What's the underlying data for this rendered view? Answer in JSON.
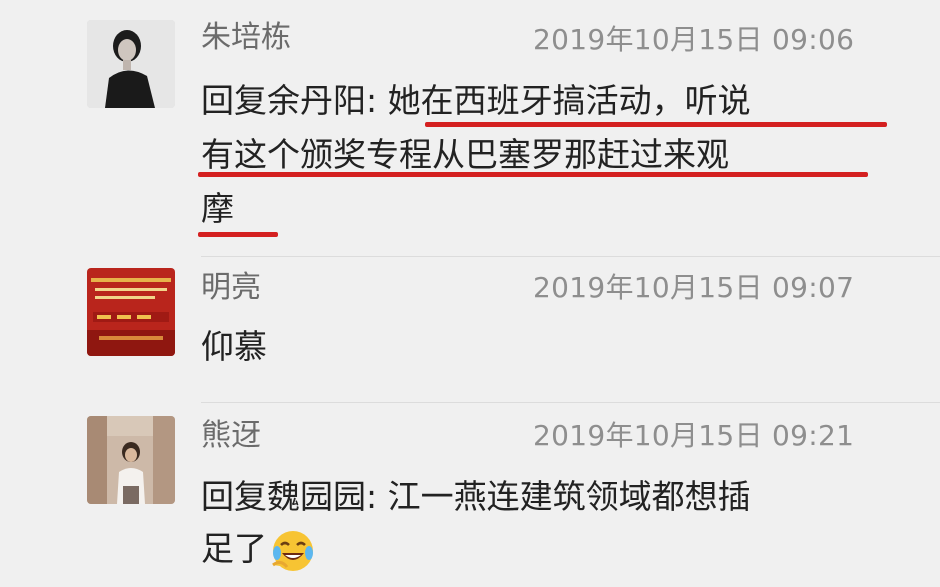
{
  "comments": [
    {
      "author": "朱培栋",
      "time": "2019年10月15日 09:06",
      "reply_prefix": "回复",
      "reply_to": "余丹阳",
      "reply_colon": ": ",
      "text_line1": "她在西班牙搞活动，听说",
      "text_line2": "有这个颁奖专程从巴塞罗那赶过来观",
      "text_line3": "摩",
      "highlight_color": "#d42020"
    },
    {
      "author": "明亮",
      "time": "2019年10月15日 09:07",
      "text": "仰慕"
    },
    {
      "author": "熊迓",
      "time": "2019年10月15日 09:21",
      "reply_prefix": "回复",
      "reply_to": "魏园园",
      "reply_colon": ": ",
      "text_line1": "江一燕连建筑领域都想插",
      "text_line2": "足了",
      "emoji": "laughing-crying-emoji"
    }
  ],
  "colors": {
    "background": "#f0f0f0",
    "name": "#6b6b6b",
    "time": "#8e8e8e",
    "text": "#222222",
    "underline": "#d42020"
  }
}
